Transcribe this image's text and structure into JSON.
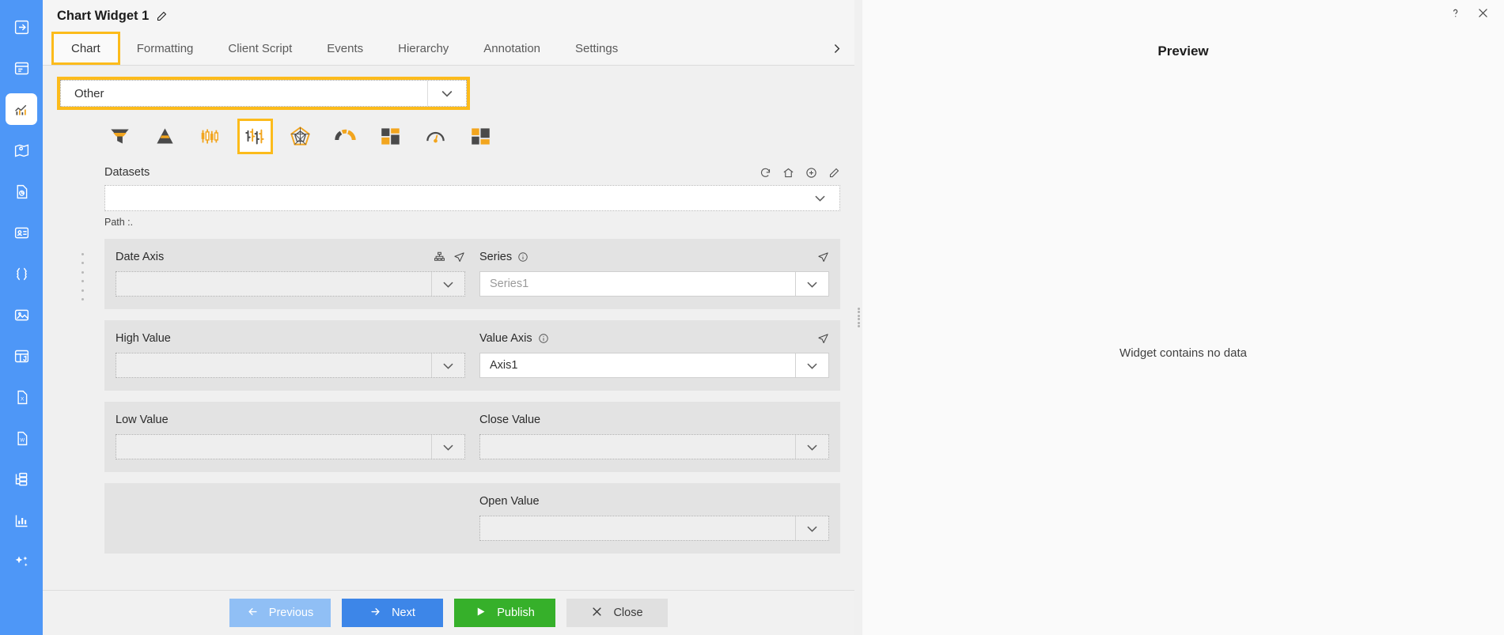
{
  "rail": {
    "items": [
      {
        "icon": "login-arrow-icon",
        "name": "sidebar-item-login",
        "active": false
      },
      {
        "icon": "dashboard-icon",
        "name": "sidebar-item-dashboard",
        "active": false
      },
      {
        "icon": "chart-icon",
        "name": "sidebar-item-chart",
        "active": true
      },
      {
        "icon": "map-icon",
        "name": "sidebar-item-map",
        "active": false
      },
      {
        "icon": "report-icon",
        "name": "sidebar-item-report",
        "active": false
      },
      {
        "icon": "contact-card-icon",
        "name": "sidebar-item-card",
        "active": false
      },
      {
        "icon": "braces-icon",
        "name": "sidebar-item-json",
        "active": false
      },
      {
        "icon": "image-icon",
        "name": "sidebar-item-image",
        "active": false
      },
      {
        "icon": "table-icon",
        "name": "sidebar-item-table",
        "active": false
      },
      {
        "icon": "excel-file-icon",
        "name": "sidebar-item-excel",
        "active": false
      },
      {
        "icon": "word-file-icon",
        "name": "sidebar-item-word",
        "active": false
      },
      {
        "icon": "tree-folder-icon",
        "name": "sidebar-item-tree",
        "active": false
      },
      {
        "icon": "bar-chart-icon",
        "name": "sidebar-item-analytics",
        "active": false
      },
      {
        "icon": "sparkle-icon",
        "name": "sidebar-item-ai",
        "active": false
      }
    ]
  },
  "editor": {
    "title": "Chart Widget 1",
    "edit_icon": "pencil-edit-icon",
    "tabs": [
      {
        "label": "Chart",
        "selected": true
      },
      {
        "label": "Formatting",
        "selected": false
      },
      {
        "label": "Client Script",
        "selected": false
      },
      {
        "label": "Events",
        "selected": false
      },
      {
        "label": "Hierarchy",
        "selected": false
      },
      {
        "label": "Annotation",
        "selected": false
      },
      {
        "label": "Settings",
        "selected": false
      }
    ],
    "tabs_next_icon": "chevron-right-icon",
    "chart_category": {
      "value": "Other",
      "chevron_icon": "chevron-down-icon"
    },
    "chart_types": [
      {
        "name": "funnel-chart-icon",
        "selected": false
      },
      {
        "name": "pyramid-chart-icon",
        "selected": false
      },
      {
        "name": "candlestick-chart-icon",
        "selected": false
      },
      {
        "name": "ohlc-chart-icon",
        "selected": true
      },
      {
        "name": "radar-chart-icon",
        "selected": false
      },
      {
        "name": "gauge-arc-chart-icon",
        "selected": false
      },
      {
        "name": "treemap-chart-icon",
        "selected": false
      },
      {
        "name": "speedometer-chart-icon",
        "selected": false
      },
      {
        "name": "tilemap-chart-icon",
        "selected": false
      }
    ],
    "datasets": {
      "label": "Datasets",
      "value": "",
      "chevron_icon": "chevron-down-icon",
      "tools": [
        {
          "name": "refresh-icon"
        },
        {
          "name": "home-icon"
        },
        {
          "name": "add-circle-icon"
        },
        {
          "name": "edit-square-icon"
        }
      ]
    },
    "path": {
      "label": "Path :."
    },
    "groups": [
      {
        "name": "date-axis-series-group",
        "fields": [
          {
            "name": "date-axis",
            "label": "Date Axis",
            "value": "",
            "placeholder": "",
            "info": false,
            "white": false,
            "chevron_icon": "chevron-down-icon",
            "tools": [
              {
                "name": "hierarchy-icon"
              },
              {
                "name": "send-icon"
              }
            ]
          },
          {
            "name": "series",
            "label": "Series",
            "value": "",
            "placeholder": "Series1",
            "info": true,
            "white": true,
            "chevron_icon": "chevron-down-icon",
            "tools": [
              {
                "name": "send-icon"
              }
            ]
          }
        ]
      },
      {
        "name": "high-value-axis-group",
        "fields": [
          {
            "name": "high-value",
            "label": "High Value",
            "value": "",
            "placeholder": "",
            "info": false,
            "white": false,
            "chevron_icon": "chevron-down-icon",
            "tools": []
          },
          {
            "name": "value-axis",
            "label": "Value Axis",
            "value": "Axis1",
            "placeholder": "",
            "info": true,
            "white": true,
            "chevron_icon": "chevron-down-icon",
            "tools": [
              {
                "name": "send-icon"
              }
            ]
          }
        ]
      },
      {
        "name": "low-close-value-group",
        "fields": [
          {
            "name": "low-value",
            "label": "Low Value",
            "value": "",
            "placeholder": "",
            "info": false,
            "white": false,
            "chevron_icon": "chevron-down-icon",
            "tools": []
          },
          {
            "name": "close-value",
            "label": "Close Value",
            "value": "",
            "placeholder": "",
            "info": false,
            "white": false,
            "chevron_icon": "chevron-down-icon",
            "tools": []
          }
        ]
      },
      {
        "name": "open-value-group",
        "single": true,
        "fields": [
          {
            "name": "open-value",
            "label": "Open Value",
            "value": "",
            "placeholder": "",
            "info": false,
            "white": false,
            "chevron_icon": "chevron-down-icon",
            "tools": []
          }
        ]
      }
    ],
    "footer": {
      "previous": {
        "label": "Previous",
        "icon": "arrow-left-icon"
      },
      "next": {
        "label": "Next",
        "icon": "arrow-right-icon"
      },
      "publish": {
        "label": "Publish",
        "icon": "play-icon"
      },
      "close": {
        "label": "Close",
        "icon": "close-x-icon"
      }
    }
  },
  "preview": {
    "title": "Preview",
    "empty_message": "Widget contains no data",
    "help_icon": "help-question-icon",
    "close_icon": "close-x-icon"
  },
  "colors": {
    "rail": "#4e97f7",
    "accent_highlight": "#fcbb1b",
    "chart_orange": "#f2a51e",
    "chart_dark": "#4a4a4a",
    "publish_green": "#36b02a",
    "next_blue": "#3d86e8",
    "prev_blue": "#90bff5"
  }
}
